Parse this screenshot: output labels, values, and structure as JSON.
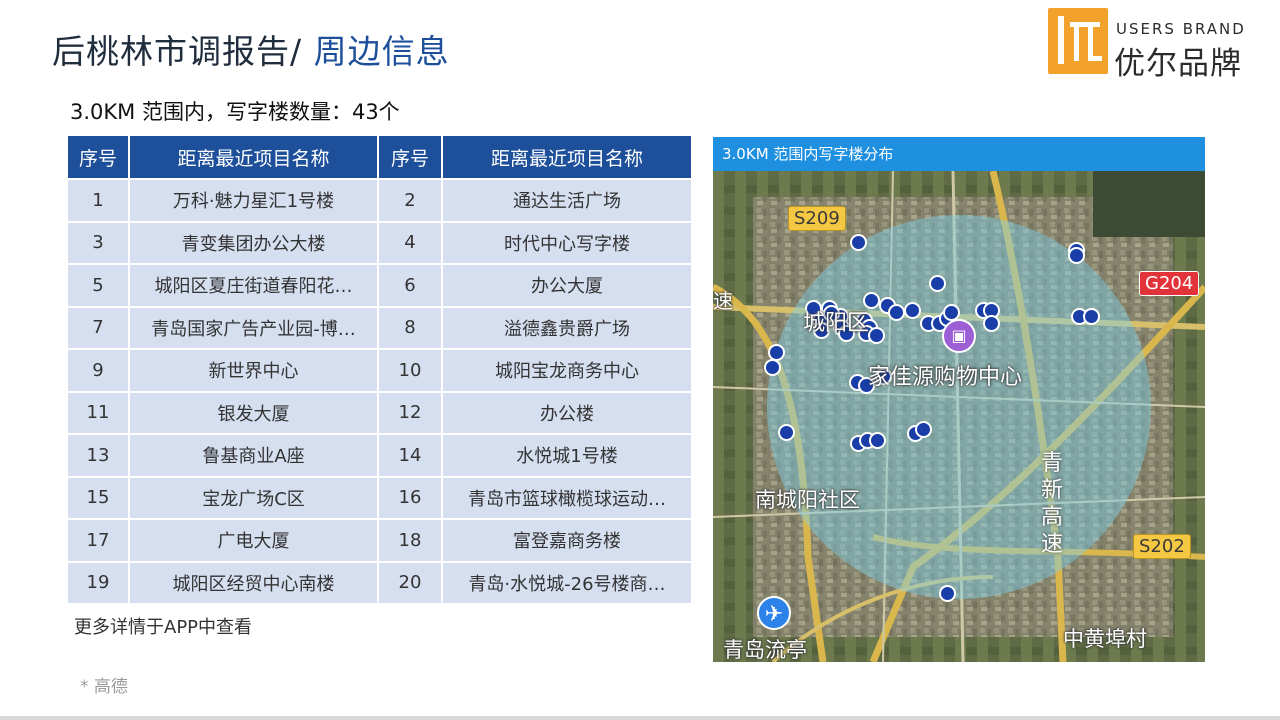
{
  "page": {
    "title_main": "后桃林市调报告/",
    "title_accent": " 周边信息",
    "subtitle": "3.0KM 范围内，写字楼数量：43个",
    "more_note": "更多详情于APP中查看",
    "source_note": "* 高德"
  },
  "brand": {
    "name_en": "USERS BRAND",
    "name_cn": "优尔品牌",
    "accent_color": "#f2a12b"
  },
  "table": {
    "headers": [
      "序号",
      "距离最近项目名称",
      "序号",
      "距离最近项目名称"
    ],
    "header_color": "#1d4f9a",
    "row_color": "#d6dff0",
    "rows": [
      [
        "1",
        "万科·魅力星汇1号楼",
        "2",
        "通达生活广场"
      ],
      [
        "3",
        "青变集团办公大楼",
        "4",
        "时代中心写字楼"
      ],
      [
        "5",
        "城阳区夏庄街道春阳花…",
        "6",
        "办公大厦"
      ],
      [
        "7",
        "青岛国家广告产业园-博…",
        "8",
        "溢德鑫贵爵广场"
      ],
      [
        "9",
        "新世界中心",
        "10",
        "城阳宝龙商务中心"
      ],
      [
        "11",
        "银发大厦",
        "12",
        "办公楼"
      ],
      [
        "13",
        "鲁基商业A座",
        "14",
        "水悦城1号楼"
      ],
      [
        "15",
        "宝龙广场C区",
        "16",
        "青岛市篮球橄榄球运动…"
      ],
      [
        "17",
        "广电大厦",
        "18",
        "富登嘉商务楼"
      ],
      [
        "19",
        "城阳区经贸中心南楼",
        "20",
        "青岛·水悦城-26号楼商…"
      ]
    ]
  },
  "map": {
    "header": "3.0KM 范围内写字楼分布",
    "labels": {
      "district_north": "城阳区",
      "mall": "家佳源购物中心",
      "district_south": "南城阳社区",
      "airport": "青岛流亭",
      "village": "中黄埠村",
      "expressway": "青新高速",
      "speed": "速"
    },
    "shields": {
      "s209": "S209",
      "g204": "G204",
      "s202": "S202"
    },
    "icons": [
      "airport-icon",
      "shopping-mall-icon",
      "location-pin-icon",
      "office-poi-dot"
    ],
    "radius_text": "3.0KM"
  }
}
